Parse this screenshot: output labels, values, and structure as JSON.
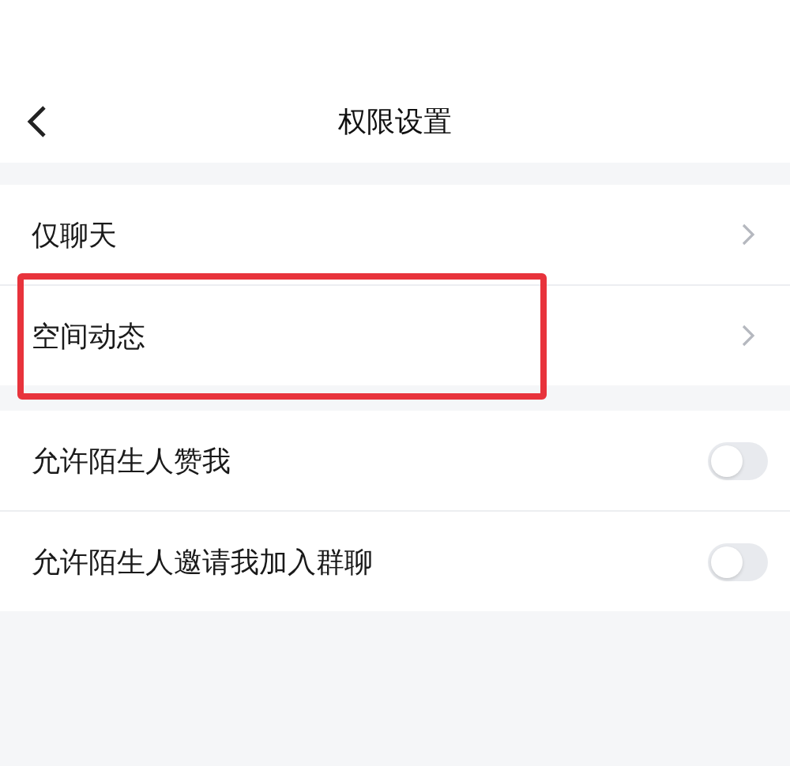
{
  "header": {
    "title": "权限设置"
  },
  "groups": [
    {
      "rows": [
        {
          "kind": "link",
          "label": "仅聊天",
          "highlighted": false
        },
        {
          "kind": "link",
          "label": "空间动态",
          "highlighted": true
        }
      ]
    },
    {
      "rows": [
        {
          "kind": "toggle",
          "label": "允许陌生人赞我",
          "on": false
        },
        {
          "kind": "toggle",
          "label": "允许陌生人邀请我加入群聊",
          "on": false
        }
      ]
    }
  ]
}
